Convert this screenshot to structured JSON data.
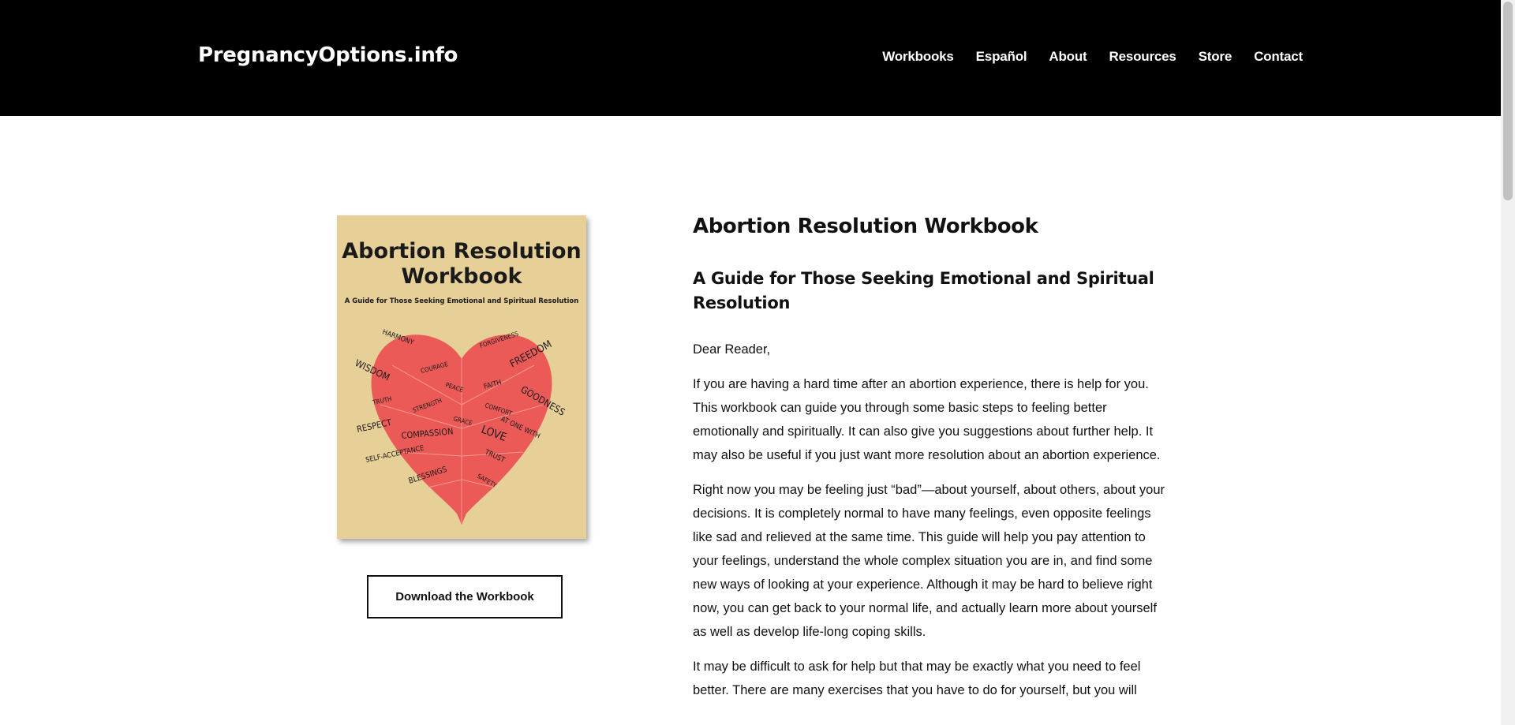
{
  "header": {
    "logo": "PregnancyOptions.info",
    "nav": [
      "Workbooks",
      "Español",
      "About",
      "Resources",
      "Store",
      "Contact"
    ]
  },
  "cover": {
    "title_line1": "Abortion Resolution",
    "title_line2": "Workbook",
    "subtitle": "A Guide for Those Seeking Emotional and Spiritual Resolution",
    "words": [
      "HARMONY",
      "FORGIVENESS",
      "WISDOM",
      "COURAGE",
      "FREEDOM",
      "PEACE",
      "FAITH",
      "GOODNESS",
      "TRUTH",
      "STRENGTH",
      "COMFORT",
      "RESPECT",
      "GRACE",
      "AT ONE WITH",
      "COMPASSION",
      "LOVE",
      "SELF-ACCEPTANCE",
      "TRUST",
      "BLESSINGS",
      "SAFETY"
    ],
    "colors": {
      "background": "#e7cf98",
      "heart": "#ec5a58"
    }
  },
  "download_button": "Download the Workbook",
  "content": {
    "title": "Abortion Resolution Workbook",
    "subtitle": "A Guide for Those Seeking Emotional and Spiritual Resolution",
    "greeting": "Dear Reader,",
    "paragraphs": [
      "If you are having a hard time after an abortion experience, there is help for you. This workbook can guide you through some basic steps to feeling better emotionally and spiritually. It can also give you suggestions about further help. It may also be useful if you just want more resolution about an abortion experience.",
      "Right now you may be feeling just “bad”—about yourself, about others, about your decisions. It is completely normal to have many feelings, even opposite feelings like sad and relieved at the same time. This guide will help you pay attention to your feelings, understand the whole complex situation you are in, and find some new ways of looking at your experience. Although it may be hard to believe right now, you can get back to your normal life, and actually learn more about yourself as well as develop life-long coping skills.",
      "It may be difficult to ask for help but that may be exactly what you need to feel better. There are many exercises that you have to do for yourself, but you will"
    ]
  }
}
